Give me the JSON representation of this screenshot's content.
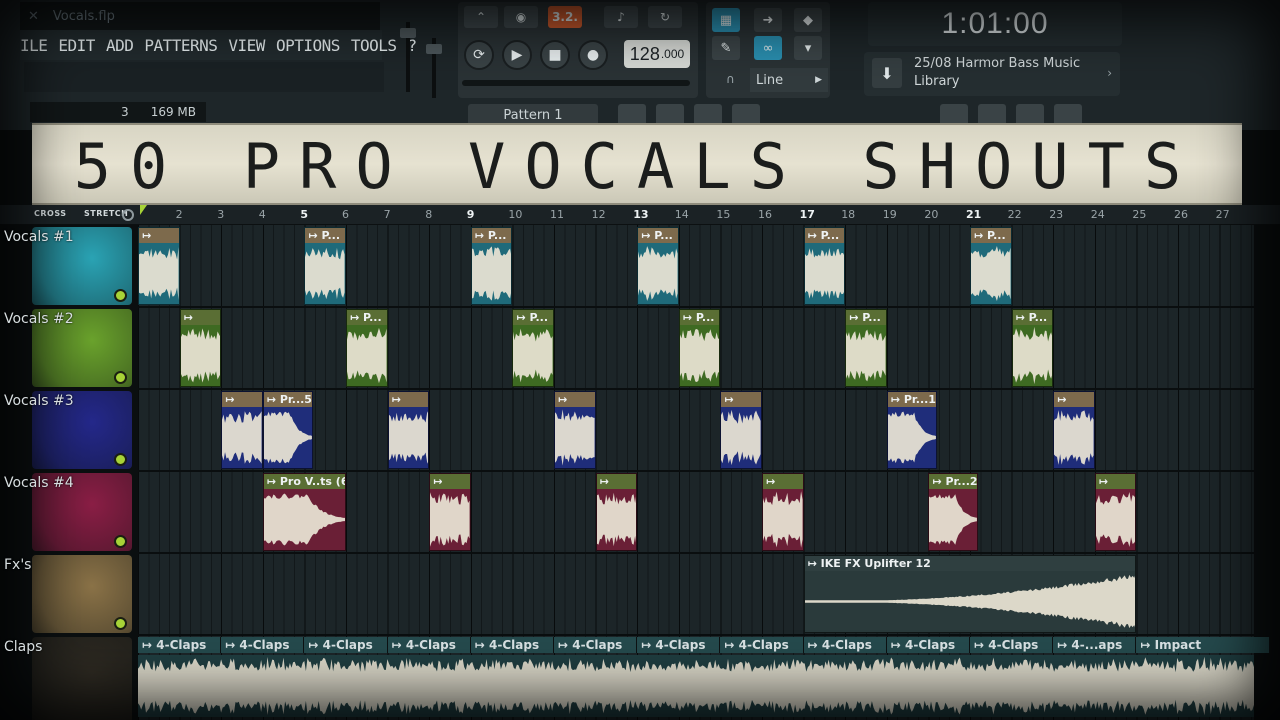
{
  "window": {
    "title": "Vocals.flp"
  },
  "menu": [
    "ILE",
    "EDIT",
    "ADD",
    "PATTERNS",
    "VIEW",
    "OPTIONS",
    "TOOLS",
    "?"
  ],
  "transport": {
    "tempo_main": "128",
    "tempo_frac": ".000",
    "mode_label": "3.2.",
    "snap_label": "Line"
  },
  "time_display": "1:01:00",
  "news": {
    "line1": "25/08  Harmor Bass Music",
    "line2": "Library"
  },
  "status": {
    "cpu": "3",
    "memory": "169 MB",
    "pattern": "Pattern 1"
  },
  "banner": {
    "title": "50 PRO VOCALS SHOUTS"
  },
  "ruler": {
    "crossfade": "CROSS",
    "stretch": "STRETCH",
    "bars": [
      "2",
      "3",
      "4",
      "5",
      "6",
      "7",
      "8",
      "9",
      "10",
      "11",
      "12",
      "13",
      "14",
      "15",
      "16",
      "17",
      "18",
      "19",
      "20",
      "21",
      "22",
      "23",
      "24",
      "25",
      "26",
      "27"
    ],
    "major_bars": [
      "5",
      "9",
      "13",
      "17",
      "21"
    ]
  },
  "tracks": [
    {
      "name": "Vocals #1",
      "color": "#2aa3b4"
    },
    {
      "name": "Vocals #2",
      "color": "#6aa22c"
    },
    {
      "name": "Vocals #3",
      "color": "#24288a"
    },
    {
      "name": "Vocals #4",
      "color": "#8a1e45"
    },
    {
      "name": "Fx's",
      "color": "#8a7247"
    },
    {
      "name": "Claps",
      "color": "#2e2a22"
    }
  ],
  "clip_colors": {
    "vocals1": "#1f6a7a",
    "vocals2": "#3e6a22",
    "vocals3": "#1f2d7a",
    "vocals4": "#6a1f36",
    "fx": "#2a3a3b",
    "claps": "#254a4d"
  },
  "clips": {
    "vocals1": [
      {
        "bar": 1,
        "len": 1,
        "label": ""
      },
      {
        "bar": 5,
        "len": 1,
        "label": "P..."
      },
      {
        "bar": 9,
        "len": 1,
        "label": "P..."
      },
      {
        "bar": 13,
        "len": 1,
        "label": "P..."
      },
      {
        "bar": 17,
        "len": 1,
        "label": "P..."
      },
      {
        "bar": 21,
        "len": 1,
        "label": "P..."
      }
    ],
    "vocals2": [
      {
        "bar": 2,
        "len": 1,
        "label": ""
      },
      {
        "bar": 6,
        "len": 1,
        "label": "P..."
      },
      {
        "bar": 10,
        "len": 1,
        "label": "P..."
      },
      {
        "bar": 14,
        "len": 1,
        "label": "P..."
      },
      {
        "bar": 18,
        "len": 1,
        "label": "P..."
      },
      {
        "bar": 22,
        "len": 1,
        "label": "P..."
      }
    ],
    "vocals3": [
      {
        "bar": 3,
        "len": 1,
        "label": ""
      },
      {
        "bar": 4,
        "len": 1.2,
        "label": "Pr...5)"
      },
      {
        "bar": 7,
        "len": 1,
        "label": ""
      },
      {
        "bar": 11,
        "len": 1,
        "label": ""
      },
      {
        "bar": 15,
        "len": 1,
        "label": ""
      },
      {
        "bar": 19,
        "len": 1.2,
        "label": "Pr...1)"
      },
      {
        "bar": 23,
        "len": 1,
        "label": ""
      }
    ],
    "vocals4": [
      {
        "bar": 4,
        "len": 2,
        "label": "Pro V..ts (6)"
      },
      {
        "bar": 8,
        "len": 1,
        "label": ""
      },
      {
        "bar": 12,
        "len": 1,
        "label": ""
      },
      {
        "bar": 16,
        "len": 1,
        "label": ""
      },
      {
        "bar": 20,
        "len": 1.2,
        "label": "Pr...2)"
      },
      {
        "bar": 24,
        "len": 1,
        "label": ""
      }
    ],
    "fx": [
      {
        "bar": 17,
        "len": 8,
        "label": "IKE FX Uplifter 12"
      }
    ]
  },
  "claps": [
    "4-Claps",
    "4-Claps",
    "4-Claps",
    "4-Claps",
    "4-Claps",
    "4-Claps",
    "4-Claps",
    "4-Claps",
    "4-Claps",
    "4-Claps",
    "4-Claps",
    "4-...aps",
    "Impact"
  ]
}
